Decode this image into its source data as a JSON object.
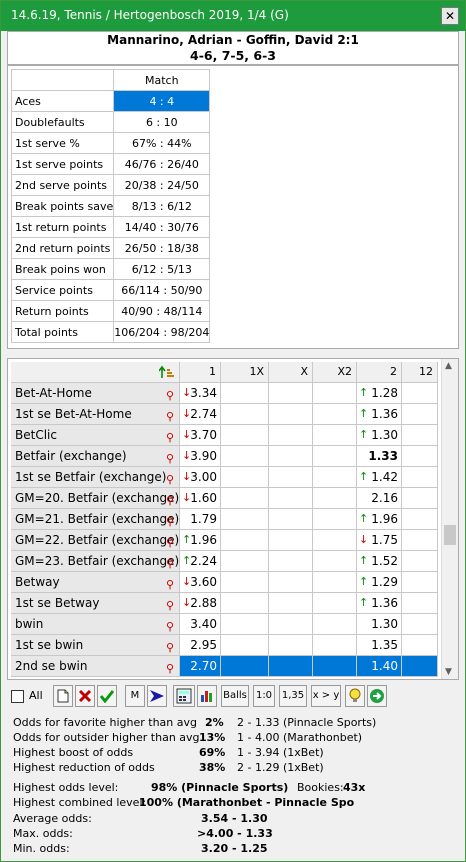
{
  "window": {
    "title": "14.6.19, Tennis / Hertogenbosch 2019, 1/4 (G)",
    "close_label": "✕"
  },
  "header": {
    "match": "Mannarino, Adrian - Goffin, David 2:1",
    "score": "4-6, 7-5, 6-3"
  },
  "stats": {
    "column_header": "Match",
    "rows": [
      {
        "label": "Aces",
        "value": "4 : 4"
      },
      {
        "label": "Doublefaults",
        "value": "6 : 10"
      },
      {
        "label": "1st serve %",
        "value": "67% : 44%"
      },
      {
        "label": "1st serve points",
        "value": "46/76 : 26/40"
      },
      {
        "label": "2nd serve points",
        "value": "20/38 : 24/50"
      },
      {
        "label": "Break points save",
        "value": "8/13 : 6/12"
      },
      {
        "label": "1st return points",
        "value": "14/40 : 30/76"
      },
      {
        "label": "2nd return points",
        "value": "26/50 : 18/38"
      },
      {
        "label": "Break poins won",
        "value": "6/12 : 5/13"
      },
      {
        "label": "Service points",
        "value": "66/114 : 50/90"
      },
      {
        "label": "Return points",
        "value": "40/90 : 48/114"
      },
      {
        "label": "Total points",
        "value": "106/204 : 98/204"
      }
    ]
  },
  "odds": {
    "sort_icon": "sort-icon",
    "columns": [
      "1",
      "1X",
      "X",
      "X2",
      "2",
      "12"
    ],
    "rows": [
      {
        "name": "Bet-At-Home",
        "c1": "3.34",
        "c1dir": "down",
        "c5": "1.28",
        "c5dir": "up"
      },
      {
        "name": "1st se Bet-At-Home",
        "c1": "2.74",
        "c1dir": "down",
        "c5": "1.36",
        "c5dir": "up"
      },
      {
        "name": "BetClic",
        "c1": "3.70",
        "c1dir": "down",
        "c5": "1.30",
        "c5dir": "up"
      },
      {
        "name": "Betfair (exchange)",
        "c1": "3.90",
        "c1dir": "down",
        "c5": "1.33",
        "c5dir": "",
        "c5bold": true
      },
      {
        "name": "1st se Betfair (exchange)",
        "c1": "3.00",
        "c1dir": "down",
        "c5": "1.42",
        "c5dir": "up"
      },
      {
        "name": "GM=20. Betfair (exchange)",
        "c1": "1.60",
        "c1dir": "down",
        "c5": "2.16",
        "c5dir": ""
      },
      {
        "name": "GM=21. Betfair (exchange)",
        "c1": "1.79",
        "c1dir": "",
        "c5": "1.96",
        "c5dir": "up"
      },
      {
        "name": "GM=22. Betfair (exchange)",
        "c1": "1.96",
        "c1dir": "up",
        "c5": "1.75",
        "c5dir": "down"
      },
      {
        "name": "GM=23. Betfair (exchange)",
        "c1": "2.24",
        "c1dir": "up",
        "c5": "1.52",
        "c5dir": "up"
      },
      {
        "name": "Betway",
        "c1": "3.60",
        "c1dir": "down",
        "c5": "1.29",
        "c5dir": "up"
      },
      {
        "name": "1st se Betway",
        "c1": "2.88",
        "c1dir": "down",
        "c5": "1.36",
        "c5dir": "up"
      },
      {
        "name": "bwin",
        "c1": "3.40",
        "c1dir": "",
        "c5": "1.30",
        "c5dir": ""
      },
      {
        "name": "1st se bwin",
        "c1": "2.95",
        "c1dir": "",
        "c5": "1.35",
        "c5dir": ""
      },
      {
        "name": "2nd se bwin",
        "c1": "2.70",
        "c1dir": "",
        "c5": "1.40",
        "c5dir": "",
        "selected": true
      }
    ]
  },
  "toolbar": {
    "all_label": "All",
    "m_label": "M",
    "balls_label": "Balls",
    "ratio_label": "1:0",
    "odds_label": "1,35",
    "xy_label": "x > y"
  },
  "info": {
    "fav_label": "Odds for favorite higher than avg",
    "fav_pct": "2%",
    "fav_val": "2 - 1.33 (Pinnacle Sports)",
    "out_label": "Odds for outsider higher than avg",
    "out_pct": "13%",
    "out_val": "1 - 4.00 (Marathonbet)",
    "boost_label": "Highest boost of odds",
    "boost_pct": "69%",
    "boost_val": "1 - 3.94 (1xBet)",
    "red_label": "Highest reduction of odds",
    "red_pct": "38%",
    "red_val": "2 - 1.29 (1xBet)",
    "level_label": "Highest odds level:",
    "level_val": "98%  (Pinnacle Sports)",
    "bookies_label": "Bookies:",
    "bookies_val": "43x",
    "comb_label": "Highest combined level:",
    "comb_val": "100%  (Marathonbet - Pinnacle Spo",
    "avg_label": "Average odds:",
    "avg_val": "3.54 - 1.30",
    "max_label": "Max. odds:",
    "max_val": ">4.00 - 1.33",
    "min_label": "Min. odds:",
    "min_val": "3.20 - 1.25"
  }
}
